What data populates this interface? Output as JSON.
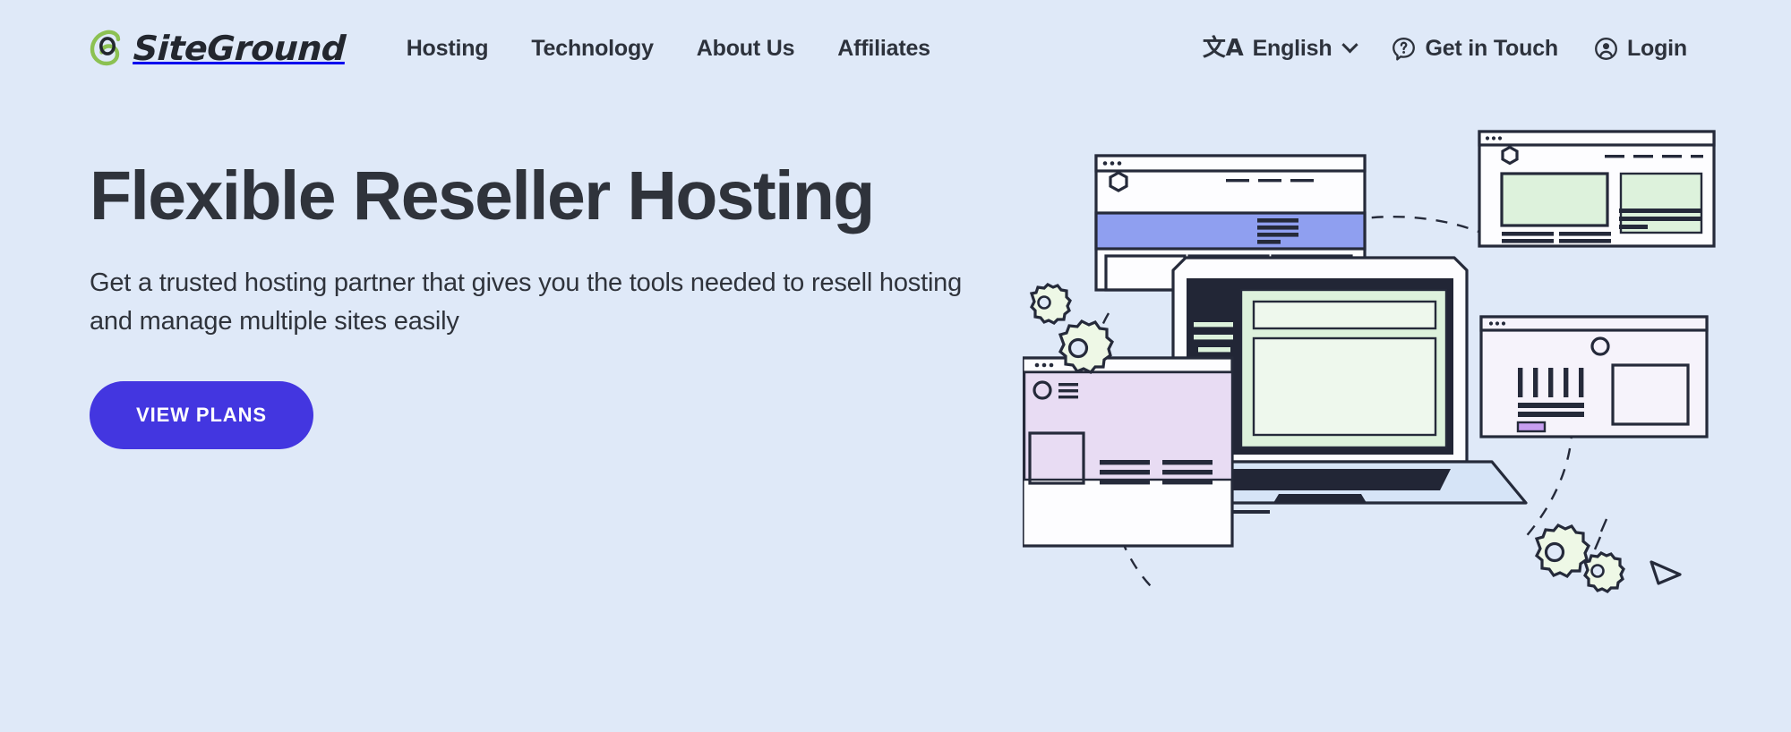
{
  "brand": {
    "name": "SiteGround",
    "logo_icon": "siteground-swirl-logo",
    "logo_color": "#8cc152"
  },
  "nav": {
    "items": [
      {
        "label": "Hosting"
      },
      {
        "label": "Technology"
      },
      {
        "label": "About Us"
      },
      {
        "label": "Affiliates"
      }
    ]
  },
  "utility": {
    "language": {
      "label": "English",
      "icon": "translate-icon",
      "glyph": "文A",
      "chevron": "chevron-down-icon"
    },
    "contact": {
      "label": "Get in Touch",
      "icon": "question-speech-bubble-icon"
    },
    "login": {
      "label": "Login",
      "icon": "user-circle-icon"
    }
  },
  "hero": {
    "title": "Flexible Reseller Hosting",
    "subtitle": "Get a trusted hosting partner that gives you the tools needed to resell hosting and manage multiple sites easily",
    "cta_label": "VIEW PLANS",
    "cta_color": "#4336e0",
    "title_color": "#2f333b"
  },
  "illustration": {
    "name": "reseller-hosting-illustration",
    "description": "Laptop with dashboard surrounded by floating browser windows, gears and a cursor arrow",
    "colors": {
      "background": "#dfe9f8",
      "stroke": "#252a3a",
      "purple_band": "#8f9ff0",
      "green_panel": "#ddf2dc",
      "lavender_panel": "#e8dcf3",
      "white_panel": "#fafafc",
      "gear_fill": "#eef8e6",
      "laptop_base": "#d6e4f7",
      "screen_bezel": "#222636",
      "accent_button": "#c79ef0"
    },
    "elements": [
      {
        "name": "browser-window-top-left"
      },
      {
        "name": "browser-window-top-right"
      },
      {
        "name": "browser-window-bottom-left"
      },
      {
        "name": "browser-window-right-floating"
      },
      {
        "name": "laptop-with-dashboard"
      },
      {
        "name": "gear-large-left"
      },
      {
        "name": "gear-small-left"
      },
      {
        "name": "gear-large-right"
      },
      {
        "name": "gear-small-right"
      },
      {
        "name": "cursor-arrow"
      },
      {
        "name": "dashed-connector-curves"
      }
    ]
  }
}
